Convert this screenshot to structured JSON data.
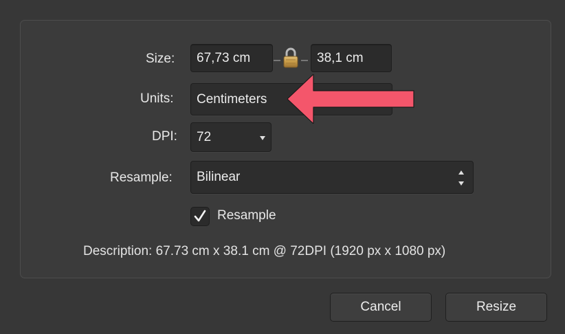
{
  "size": {
    "label": "Size:",
    "width_value": "67,73 cm",
    "height_value": "38,1 cm",
    "lock_icon": "lock-icon"
  },
  "units": {
    "label": "Units:",
    "value": "Centimeters"
  },
  "dpi": {
    "label": "DPI:",
    "value": "72"
  },
  "resample": {
    "label": "Resample:",
    "value": "Bilinear",
    "checkbox_label": "Resample",
    "checked": true
  },
  "description": "Description: 67.73 cm x 38.1 cm @ 72DPI (1920 px x 1080 px)",
  "buttons": {
    "cancel": "Cancel",
    "resize": "Resize"
  },
  "annotation": {
    "arrow_color": "#f4566b"
  }
}
